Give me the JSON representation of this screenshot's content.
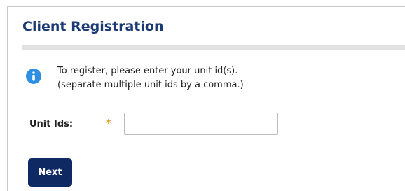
{
  "form": {
    "title": "Client Registration",
    "info_line1": "To register, please enter your unit id(s).",
    "info_line2": "(separate multiple unit ids by a comma.)",
    "field_label": "Unit Ids:",
    "required_marker": "*",
    "unit_ids_value": "",
    "next_label": "Next"
  },
  "icons": {
    "info": "info-icon"
  },
  "colors": {
    "title": "#1b3a73",
    "info_icon": "#2f8fe0",
    "required_marker": "#e0a12a",
    "button_bg": "#0f2a63",
    "rule": "#e2e2e2"
  }
}
